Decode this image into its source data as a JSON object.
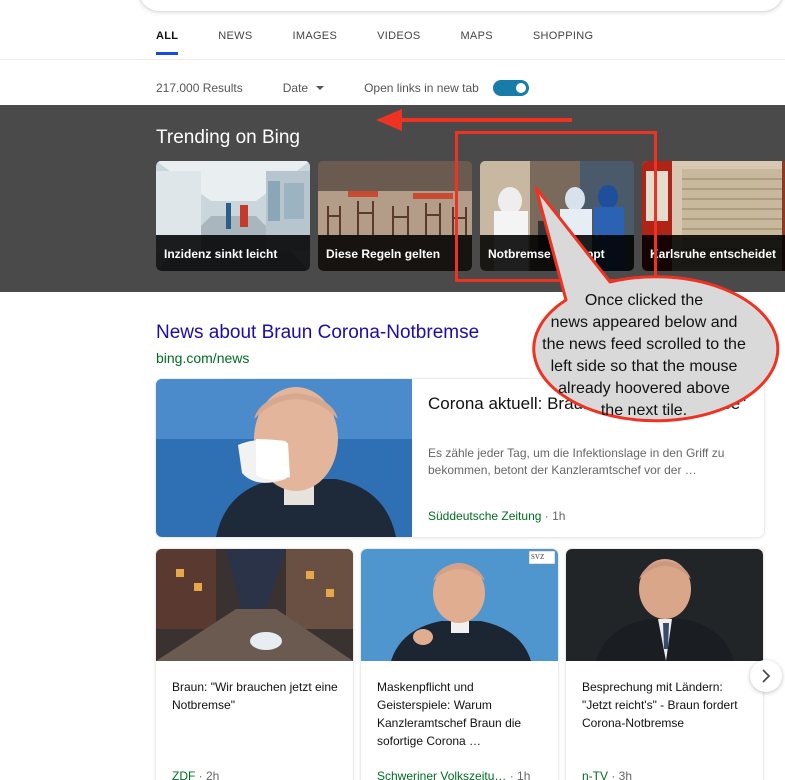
{
  "tabs": [
    {
      "label": "ALL",
      "active": true
    },
    {
      "label": "NEWS",
      "active": false
    },
    {
      "label": "IMAGES",
      "active": false
    },
    {
      "label": "VIDEOS",
      "active": false
    },
    {
      "label": "MAPS",
      "active": false
    },
    {
      "label": "SHOPPING",
      "active": false
    }
  ],
  "filters": {
    "results": "217.000 Results",
    "date_label": "Date",
    "new_tab_label": "Open links in new tab",
    "new_tab_enabled": true
  },
  "trending": {
    "title": "Trending on Bing",
    "tiles": [
      {
        "label": "Inzidenz sinkt leicht"
      },
      {
        "label": "Diese Regeln gelten"
      },
      {
        "label": "Notbremse gestoppt"
      },
      {
        "label": "Karlsruhe entscheidet"
      }
    ]
  },
  "news": {
    "title": "News about Braun Corona-Notbremse",
    "source_link": "bing.com/news",
    "main": {
      "headline": "Corona aktuell: Braun fordert \"Notbremse\"",
      "snippet": "Es zähle jeder Tag, um die Infektionslage in den Griff zu bekommen, betont der Kanzleramtschef vor der …",
      "source": "Süddeutsche Zeitung",
      "time": " · 1h"
    },
    "cards": [
      {
        "headline": "Braun: \"Wir brauchen jetzt eine Notbremse\"",
        "source": "ZDF",
        "time": " · 2h"
      },
      {
        "headline": "Maskenpflicht und Geisterspiele: Warum Kanzleramtschef Braun die sofortige Corona …",
        "source": "Schweriner Volkszeitu…",
        "time": " · 1h"
      },
      {
        "headline": "Besprechung mit Ländern: \"Jetzt reicht's\" - Braun fordert Corona-Notbremse",
        "source": "n-TV",
        "time": " · 3h"
      }
    ],
    "card_badge": "SVZ"
  },
  "annotation": {
    "text": "Once clicked the\nnews appeared below and\nthe news feed scrolled to the\nleft side so that the mouse\nalready hoovered above\nthe next tile.",
    "color": "#ee3322"
  },
  "icons": {
    "toggle": "toggle-switch-icon",
    "caret": "caret-down-icon",
    "next": "chevron-right-icon"
  }
}
